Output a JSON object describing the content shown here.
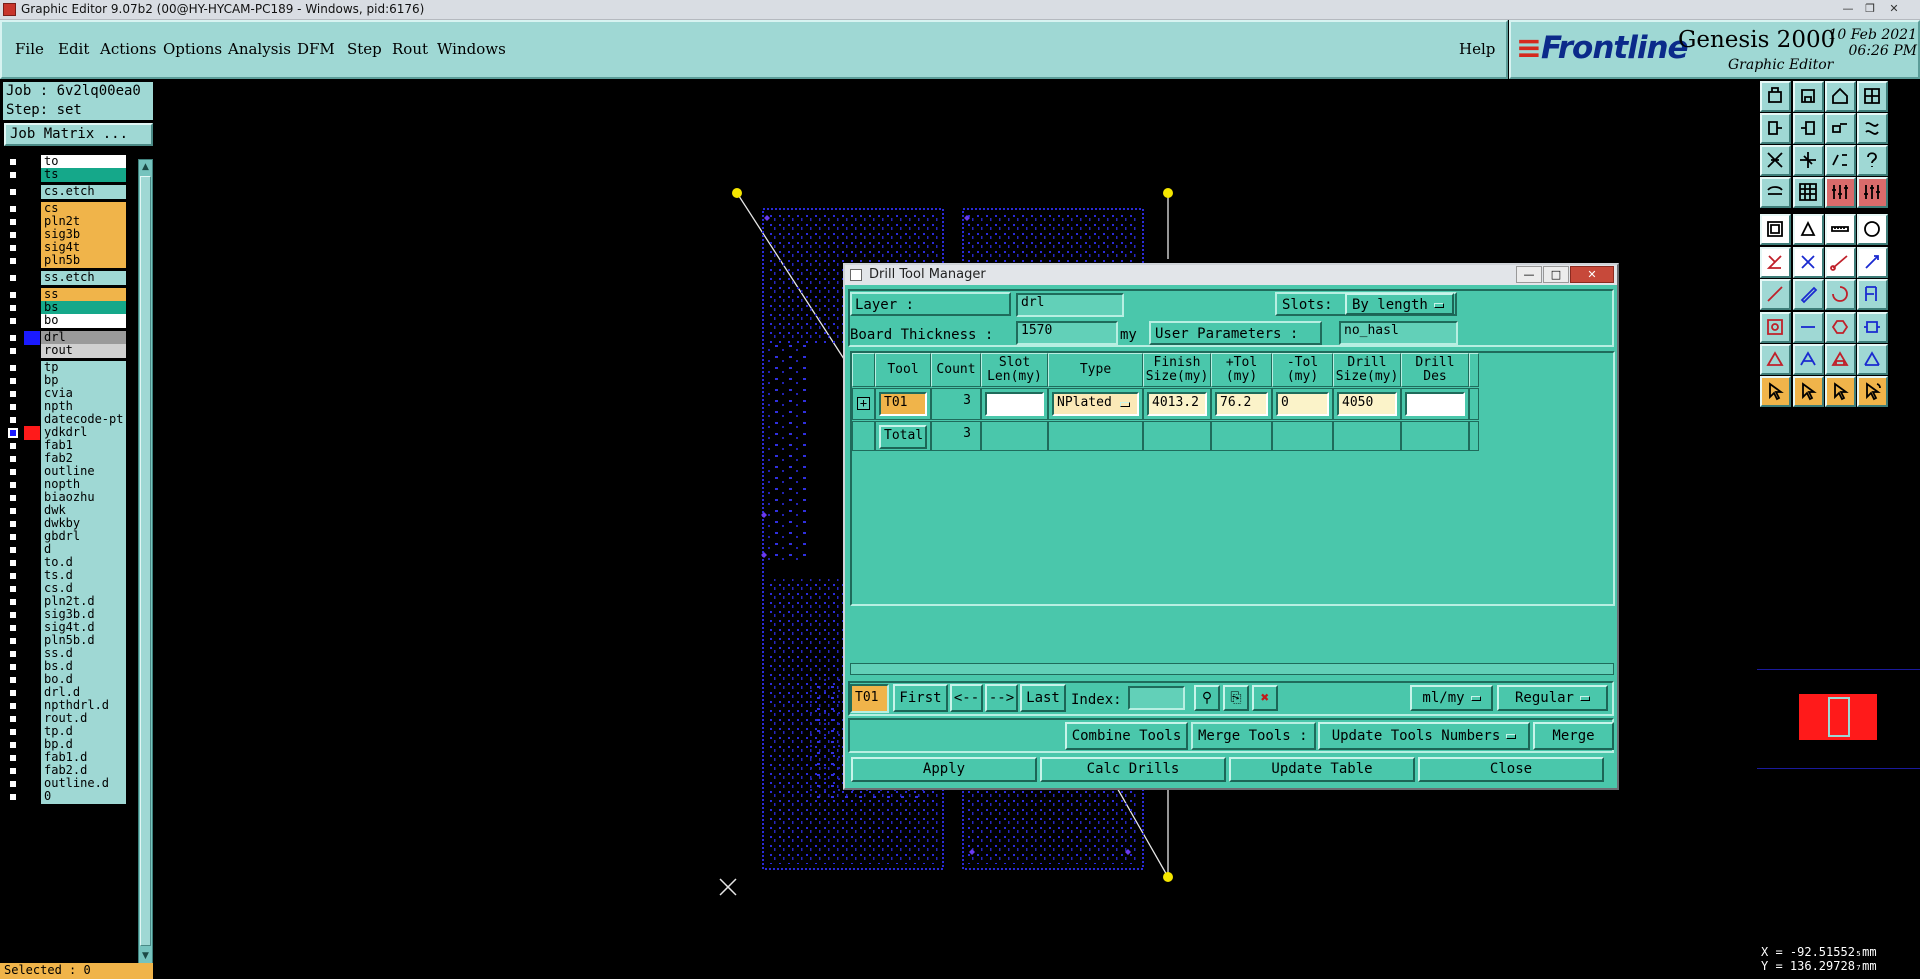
{
  "window": {
    "title": "Graphic Editor 9.07b2 (00@HY-HYCAM-PC189 - Windows, pid:6176)"
  },
  "menu": [
    "File",
    "Edit",
    "Actions",
    "Options",
    "Analysis",
    "DFM",
    "Step",
    "Rout",
    "Windows"
  ],
  "help_label": "Help",
  "branding": {
    "logo": "Frontline",
    "product": "Genesis 2000",
    "subtitle": "Graphic Editor",
    "date": "10 Feb 2021",
    "time": "06:26 PM"
  },
  "job": {
    "job_text": "Job : 6v2lq00ea0",
    "step_text": "Step: set",
    "matrix_button": "Job Matrix ..."
  },
  "layers": [
    {
      "name": "to",
      "color": "#ffffff"
    },
    {
      "name": "ts",
      "color": "#15a88a"
    },
    {
      "name": "cs.etch",
      "color": "#9fd8d4"
    },
    {
      "name": "cs",
      "color": "#f0b44a"
    },
    {
      "name": "pln2t",
      "color": "#f0b44a"
    },
    {
      "name": "sig3b",
      "color": "#f0b44a"
    },
    {
      "name": "sig4t",
      "color": "#f0b44a"
    },
    {
      "name": "pln5b",
      "color": "#f0b44a"
    },
    {
      "name": "ss.etch",
      "color": "#9fd8d4"
    },
    {
      "name": "ss",
      "color": "#f0b44a"
    },
    {
      "name": "bs",
      "color": "#15a88a"
    },
    {
      "name": "bo",
      "color": "#ffffff"
    },
    {
      "name": "drl",
      "color": "#9a9a9a"
    },
    {
      "name": "rout",
      "color": "#d0d0d0"
    },
    {
      "name": "tp",
      "color": "#9fd8d4"
    },
    {
      "name": "bp",
      "color": "#9fd8d4"
    },
    {
      "name": "cvia",
      "color": "#9fd8d4"
    },
    {
      "name": "npth",
      "color": "#9fd8d4"
    },
    {
      "name": "datecode-pt",
      "color": "#9fd8d4"
    },
    {
      "name": "ydkdrl",
      "color": "#9fd8d4"
    },
    {
      "name": "fab1",
      "color": "#9fd8d4"
    },
    {
      "name": "fab2",
      "color": "#9fd8d4"
    },
    {
      "name": "outline",
      "color": "#9fd8d4"
    },
    {
      "name": "nopth",
      "color": "#9fd8d4"
    },
    {
      "name": "biaozhu",
      "color": "#9fd8d4"
    },
    {
      "name": "dwk",
      "color": "#9fd8d4"
    },
    {
      "name": "dwkby",
      "color": "#9fd8d4"
    },
    {
      "name": "gbdrl",
      "color": "#9fd8d4"
    },
    {
      "name": "d",
      "color": "#9fd8d4"
    },
    {
      "name": "to.d",
      "color": "#9fd8d4"
    },
    {
      "name": "ts.d",
      "color": "#9fd8d4"
    },
    {
      "name": "cs.d",
      "color": "#9fd8d4"
    },
    {
      "name": "pln2t.d",
      "color": "#9fd8d4"
    },
    {
      "name": "sig3b.d",
      "color": "#9fd8d4"
    },
    {
      "name": "sig4t.d",
      "color": "#9fd8d4"
    },
    {
      "name": "pln5b.d",
      "color": "#9fd8d4"
    },
    {
      "name": "ss.d",
      "color": "#9fd8d4"
    },
    {
      "name": "bs.d",
      "color": "#9fd8d4"
    },
    {
      "name": "bo.d",
      "color": "#9fd8d4"
    },
    {
      "name": "drl.d",
      "color": "#9fd8d4"
    },
    {
      "name": "npthdrl.d",
      "color": "#9fd8d4"
    },
    {
      "name": "rout.d",
      "color": "#9fd8d4"
    },
    {
      "name": "tp.d",
      "color": "#9fd8d4"
    },
    {
      "name": "bp.d",
      "color": "#9fd8d4"
    },
    {
      "name": "fab1.d",
      "color": "#9fd8d4"
    },
    {
      "name": "fab2.d",
      "color": "#9fd8d4"
    },
    {
      "name": "outline.d",
      "color": "#9fd8d4"
    },
    {
      "name": "0",
      "color": "#9fd8d4"
    }
  ],
  "selected_text": "Selected : 0",
  "coords": {
    "x": "X = -92.51552₅mm",
    "y": "Y = 136.29728₇mm"
  },
  "dialog": {
    "title": "Drill Tool Manager",
    "layer_label": "Layer        :",
    "layer_value": "drl",
    "slots_label": "Slots:",
    "slots_value": "By length",
    "thickness_label": "Board Thickness :",
    "thickness_value": "1570",
    "thickness_unit": "my",
    "user_params_label": "User Parameters :",
    "user_params_value": "no_hasl",
    "columns": [
      "Tool",
      "Count",
      "Slot Len(my)",
      "Type",
      "Finish Size(my)",
      "+Tol (my)",
      "-Tol (my)",
      "Drill Size(my)",
      "Drill Des"
    ],
    "rows": [
      {
        "tool": "T01",
        "count": "3",
        "slot_len": "",
        "type": "NPlated",
        "finish": "4013.2",
        "ptol": "76.2",
        "mtol": "0",
        "drill": "4050",
        "des": ""
      }
    ],
    "total_label": "Total",
    "total_count": "3",
    "nav": {
      "current": "T01",
      "first": "First",
      "prev": "<--",
      "next": "-->",
      "last": "Last",
      "index_label": "Index:",
      "units": "ml/my",
      "mode": "Regular"
    },
    "tools_row": {
      "combine": "Combine Tools",
      "merge_label": "Merge Tools :",
      "update_numbers": "Update Tools Numbers",
      "merge": "Merge"
    },
    "actions": {
      "apply": "Apply",
      "calc": "Calc Drills",
      "update": "Update Table",
      "close": "Close"
    }
  },
  "colors": {
    "panel": "#9fd8d4",
    "dialog": "#4ac7ab",
    "highlight": "#f0b44a",
    "board": "#2a2ad8",
    "profile_point": "#f5e600",
    "overview_board": "#ff1a1a"
  },
  "icons": [
    "open-icon",
    "save-icon",
    "home-icon",
    "layout-icon",
    "undo-icon",
    "redo-icon",
    "flip-icon",
    "step-icon",
    "zoom-fit-icon",
    "zoom-icon",
    "scale-icon",
    "help-icon",
    "snap-icon",
    "grid-icon",
    "measure-icon",
    "graph-icon",
    "pad-icon",
    "rectangle-icon",
    "ruler-icon",
    "circle-icon",
    "node-icon",
    "cross-icon",
    "connect-icon",
    "link-icon",
    "line-icon",
    "pen-icon",
    "arc-icon",
    "text-icon",
    "surface-icon",
    "minus-icon",
    "polygon-icon",
    "shape-icon",
    "triangle-icon",
    "triangle-arc-icon",
    "triangle-fill-icon",
    "triangle-edge-icon",
    "pointer-icon",
    "pointer-select-icon",
    "pointer-move-icon",
    "pointer-rotate-icon"
  ]
}
